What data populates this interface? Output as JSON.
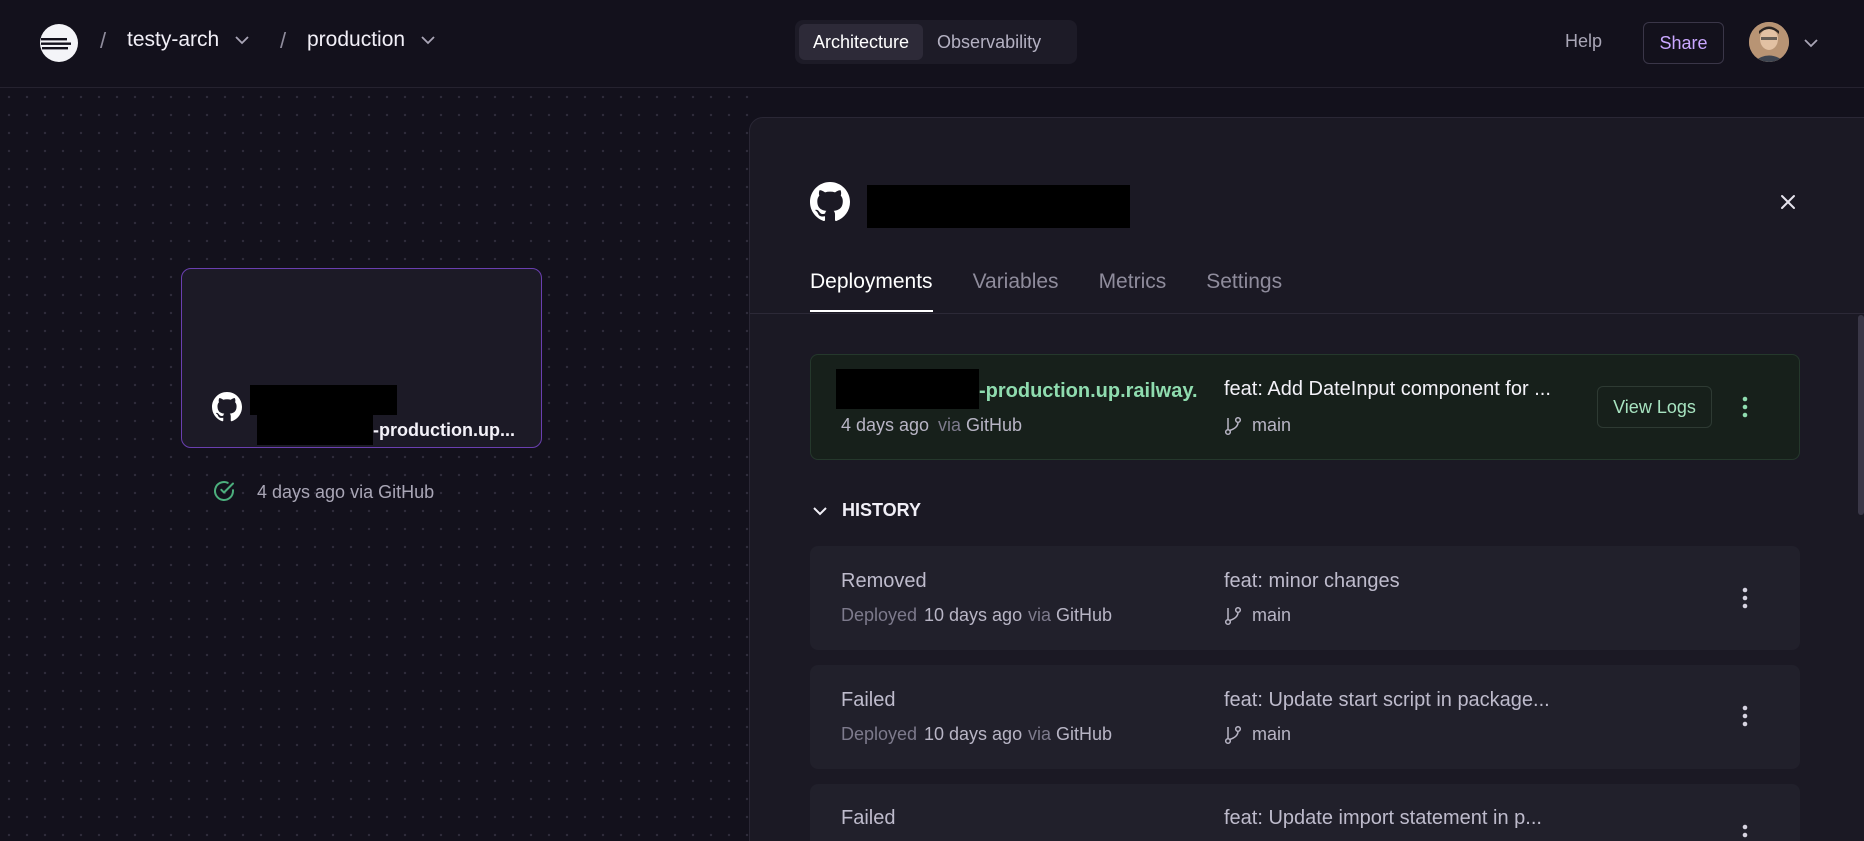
{
  "header": {
    "project": "testy-arch",
    "environment": "production",
    "separator": "/",
    "tabs": [
      {
        "label": "Architecture",
        "active": true
      },
      {
        "label": "Observability",
        "active": false
      }
    ],
    "help_label": "Help",
    "share_label": "Share"
  },
  "canvas": {
    "service_card": {
      "domain_suffix": "-production.up...",
      "status_text": "4 days ago via GitHub",
      "status_color": "#4caf7d"
    }
  },
  "panel": {
    "tabs": [
      {
        "label": "Deployments",
        "active": true
      },
      {
        "label": "Variables",
        "active": false
      },
      {
        "label": "Metrics",
        "active": false
      },
      {
        "label": "Settings",
        "active": false
      }
    ],
    "active_deployment": {
      "domain_suffix": "-production.up.railway.",
      "time": "4 days ago",
      "via_word": "via",
      "source": "GitHub",
      "commit": "feat: Add DateInput component for ...",
      "branch": "main",
      "view_logs_label": "View Logs"
    },
    "history_label": "HISTORY",
    "history": [
      {
        "status": "Removed",
        "deployed_word": "Deployed",
        "time": "10 days ago",
        "via_word": "via",
        "source": "GitHub",
        "commit": "feat: minor changes",
        "branch": "main"
      },
      {
        "status": "Failed",
        "deployed_word": "Deployed",
        "time": "10 days ago",
        "via_word": "via",
        "source": "GitHub",
        "commit": "feat: Update start script in package...",
        "branch": "main"
      },
      {
        "status": "Failed",
        "commit": "feat: Update import statement in p..."
      }
    ]
  },
  "colors": {
    "accent_purple": "#c9a7ff",
    "success_green": "#4caf7d",
    "domain_green": "#8fdcaf"
  }
}
